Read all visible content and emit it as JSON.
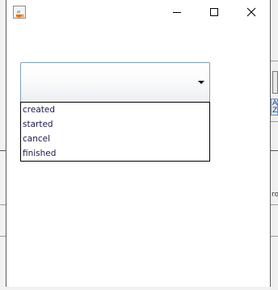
{
  "window": {
    "title": "",
    "icon": "java-coffee-cup-icon",
    "controls": {
      "minimize_icon": "minimize-icon",
      "maximize_icon": "maximize-icon",
      "close_icon": "close-icon"
    }
  },
  "combo": {
    "selected_value": "",
    "arrow_icon": "chevron-down-icon",
    "options": [
      "created",
      "started",
      "cancel",
      "finished"
    ]
  },
  "background_app": {
    "visible_fragments": [
      "A",
      "Z",
      "ro"
    ]
  },
  "colors": {
    "combo_border": "#7f9db9",
    "popup_border": "#000000",
    "option_text": "#1a1a4d"
  }
}
